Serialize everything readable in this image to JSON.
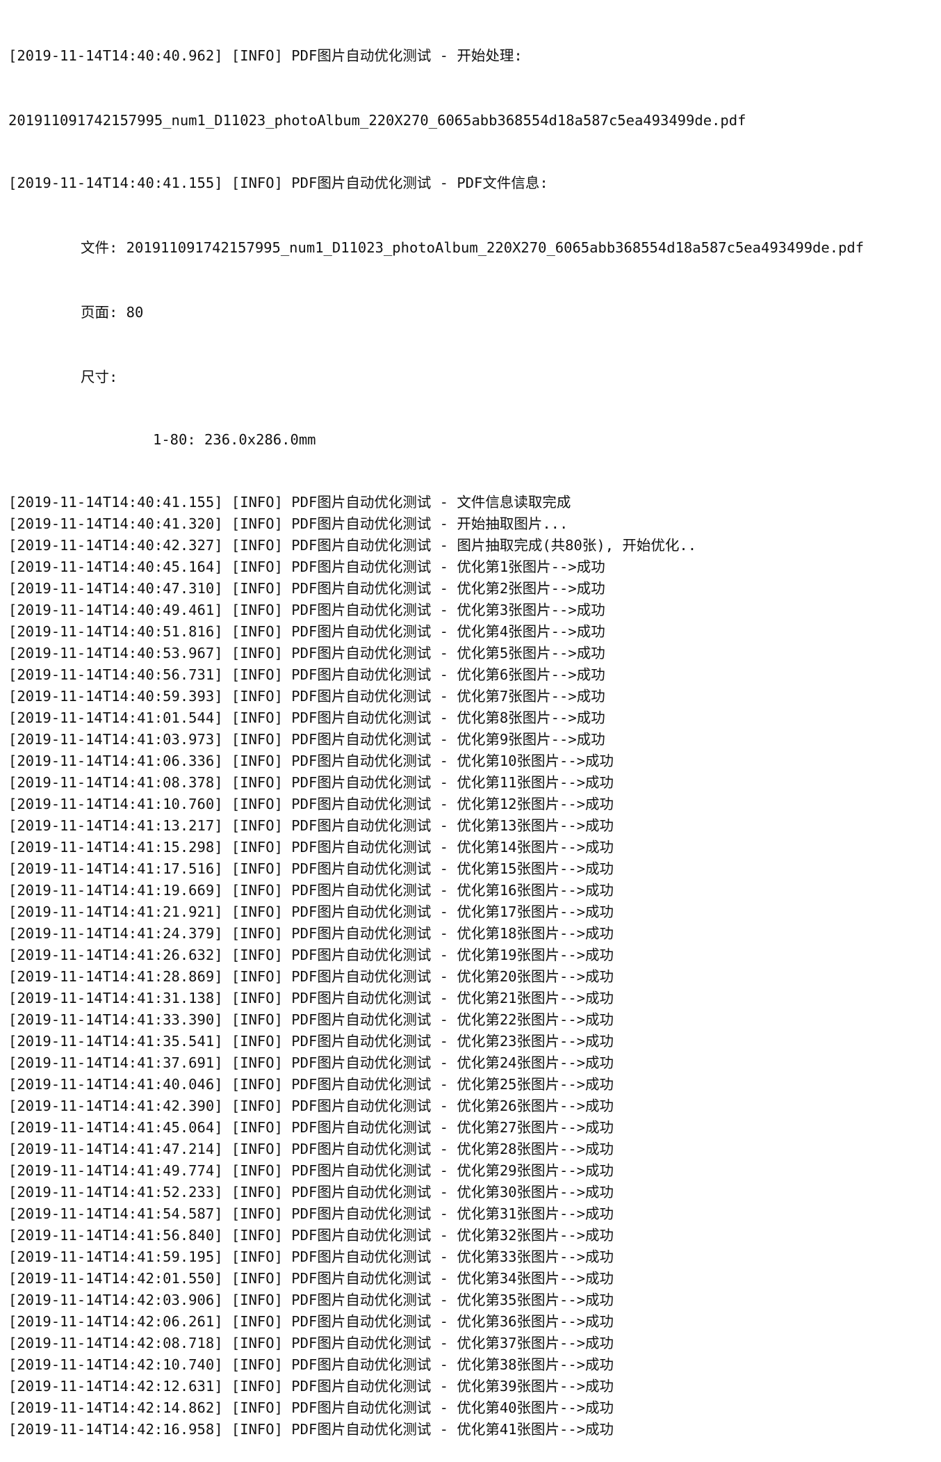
{
  "log": {
    "header_lines": [
      "[2019-11-14T14:40:40.962] [INFO] PDF图片自动优化测试 - 开始处理:",
      "201911091742157995_num1_D11023_photoAlbum_220X270_6065abb368554d18a587c5ea493499de.pdf",
      "[2019-11-14T14:40:41.155] [INFO] PDF图片自动优化测试 - PDF文件信息:"
    ],
    "file_info": {
      "file_line": "文件: 201911091742157995_num1_D11023_photoAlbum_220X270_6065abb368554d18a587c5ea493499de.pdf",
      "pages_line": "页面: 80",
      "size_label_line": "尺寸:",
      "size_value_line": "1-80: 236.0x286.0mm"
    },
    "entries": [
      "[2019-11-14T14:40:41.155] [INFO] PDF图片自动优化测试 - 文件信息读取完成",
      "[2019-11-14T14:40:41.320] [INFO] PDF图片自动优化测试 - 开始抽取图片...",
      "[2019-11-14T14:40:42.327] [INFO] PDF图片自动优化测试 - 图片抽取完成(共80张), 开始优化..",
      "[2019-11-14T14:40:45.164] [INFO] PDF图片自动优化测试 - 优化第1张图片-->成功",
      "[2019-11-14T14:40:47.310] [INFO] PDF图片自动优化测试 - 优化第2张图片-->成功",
      "[2019-11-14T14:40:49.461] [INFO] PDF图片自动优化测试 - 优化第3张图片-->成功",
      "[2019-11-14T14:40:51.816] [INFO] PDF图片自动优化测试 - 优化第4张图片-->成功",
      "[2019-11-14T14:40:53.967] [INFO] PDF图片自动优化测试 - 优化第5张图片-->成功",
      "[2019-11-14T14:40:56.731] [INFO] PDF图片自动优化测试 - 优化第6张图片-->成功",
      "[2019-11-14T14:40:59.393] [INFO] PDF图片自动优化测试 - 优化第7张图片-->成功",
      "[2019-11-14T14:41:01.544] [INFO] PDF图片自动优化测试 - 优化第8张图片-->成功",
      "[2019-11-14T14:41:03.973] [INFO] PDF图片自动优化测试 - 优化第9张图片-->成功",
      "[2019-11-14T14:41:06.336] [INFO] PDF图片自动优化测试 - 优化第10张图片-->成功",
      "[2019-11-14T14:41:08.378] [INFO] PDF图片自动优化测试 - 优化第11张图片-->成功",
      "[2019-11-14T14:41:10.760] [INFO] PDF图片自动优化测试 - 优化第12张图片-->成功",
      "[2019-11-14T14:41:13.217] [INFO] PDF图片自动优化测试 - 优化第13张图片-->成功",
      "[2019-11-14T14:41:15.298] [INFO] PDF图片自动优化测试 - 优化第14张图片-->成功",
      "[2019-11-14T14:41:17.516] [INFO] PDF图片自动优化测试 - 优化第15张图片-->成功",
      "[2019-11-14T14:41:19.669] [INFO] PDF图片自动优化测试 - 优化第16张图片-->成功",
      "[2019-11-14T14:41:21.921] [INFO] PDF图片自动优化测试 - 优化第17张图片-->成功",
      "[2019-11-14T14:41:24.379] [INFO] PDF图片自动优化测试 - 优化第18张图片-->成功",
      "[2019-11-14T14:41:26.632] [INFO] PDF图片自动优化测试 - 优化第19张图片-->成功",
      "[2019-11-14T14:41:28.869] [INFO] PDF图片自动优化测试 - 优化第20张图片-->成功",
      "[2019-11-14T14:41:31.138] [INFO] PDF图片自动优化测试 - 优化第21张图片-->成功",
      "[2019-11-14T14:41:33.390] [INFO] PDF图片自动优化测试 - 优化第22张图片-->成功",
      "[2019-11-14T14:41:35.541] [INFO] PDF图片自动优化测试 - 优化第23张图片-->成功",
      "[2019-11-14T14:41:37.691] [INFO] PDF图片自动优化测试 - 优化第24张图片-->成功",
      "[2019-11-14T14:41:40.046] [INFO] PDF图片自动优化测试 - 优化第25张图片-->成功",
      "[2019-11-14T14:41:42.390] [INFO] PDF图片自动优化测试 - 优化第26张图片-->成功",
      "[2019-11-14T14:41:45.064] [INFO] PDF图片自动优化测试 - 优化第27张图片-->成功",
      "[2019-11-14T14:41:47.214] [INFO] PDF图片自动优化测试 - 优化第28张图片-->成功",
      "[2019-11-14T14:41:49.774] [INFO] PDF图片自动优化测试 - 优化第29张图片-->成功",
      "[2019-11-14T14:41:52.233] [INFO] PDF图片自动优化测试 - 优化第30张图片-->成功",
      "[2019-11-14T14:41:54.587] [INFO] PDF图片自动优化测试 - 优化第31张图片-->成功",
      "[2019-11-14T14:41:56.840] [INFO] PDF图片自动优化测试 - 优化第32张图片-->成功",
      "[2019-11-14T14:41:59.195] [INFO] PDF图片自动优化测试 - 优化第33张图片-->成功",
      "[2019-11-14T14:42:01.550] [INFO] PDF图片自动优化测试 - 优化第34张图片-->成功",
      "[2019-11-14T14:42:03.906] [INFO] PDF图片自动优化测试 - 优化第35张图片-->成功",
      "[2019-11-14T14:42:06.261] [INFO] PDF图片自动优化测试 - 优化第36张图片-->成功",
      "[2019-11-14T14:42:08.718] [INFO] PDF图片自动优化测试 - 优化第37张图片-->成功",
      "[2019-11-14T14:42:10.740] [INFO] PDF图片自动优化测试 - 优化第38张图片-->成功",
      "[2019-11-14T14:42:12.631] [INFO] PDF图片自动优化测试 - 优化第39张图片-->成功",
      "[2019-11-14T14:42:14.862] [INFO] PDF图片自动优化测试 - 优化第40张图片-->成功",
      "[2019-11-14T14:42:16.958] [INFO] PDF图片自动优化测试 - 优化第41张图片-->成功"
    ]
  }
}
